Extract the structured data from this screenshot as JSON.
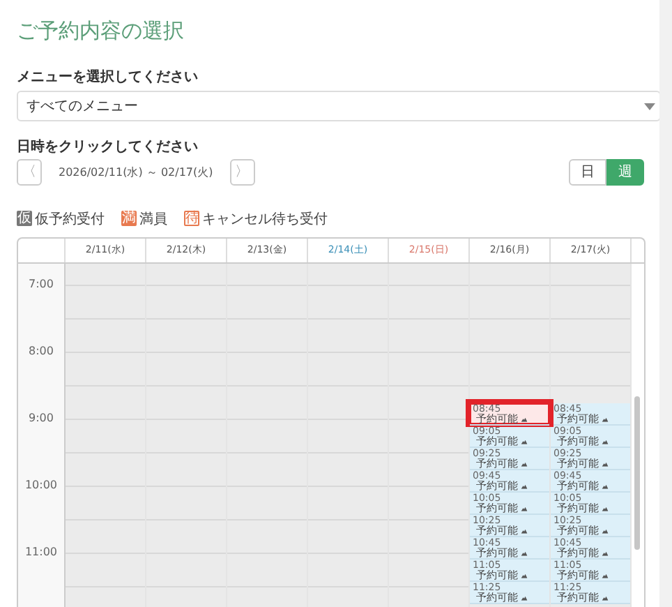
{
  "title": "ご予約内容の選択",
  "menu_label": "メニューを選択してください",
  "menu_select": {
    "value": "すべてのメニュー"
  },
  "date_label": "日時をクリックしてください",
  "date_range": "2026/02/11(水) ～ 02/17(火)",
  "prev_glyph": "〈",
  "next_glyph": "〉",
  "view_toggle": [
    {
      "label": "日",
      "selected": false
    },
    {
      "label": "週",
      "selected": true
    }
  ],
  "legend": [
    {
      "kind": "tentative",
      "mark": "仮",
      "label": "仮予約受付"
    },
    {
      "kind": "full",
      "mark": "満",
      "label": "満員"
    },
    {
      "kind": "waitlist",
      "mark": "待",
      "label": "キャンセル待ち受付"
    }
  ],
  "days": [
    {
      "label": "2/11(水)",
      "kind": "weekday"
    },
    {
      "label": "2/12(木)",
      "kind": "weekday"
    },
    {
      "label": "2/13(金)",
      "kind": "weekday"
    },
    {
      "label": "2/14(土)",
      "kind": "sat"
    },
    {
      "label": "2/15(日)",
      "kind": "sun"
    },
    {
      "label": "2/16(月)",
      "kind": "weekday",
      "slots": [
        {
          "time": "08:45",
          "label": "予約可能",
          "highlighted": true
        },
        {
          "time": "09:05",
          "label": "予約可能",
          "highlighted": false
        },
        {
          "time": "09:25",
          "label": "予約可能",
          "highlighted": false
        },
        {
          "time": "09:45",
          "label": "予約可能",
          "highlighted": false
        },
        {
          "time": "10:05",
          "label": "予約可能",
          "highlighted": false
        },
        {
          "time": "10:25",
          "label": "予約可能",
          "highlighted": false
        },
        {
          "time": "10:45",
          "label": "予約可能",
          "highlighted": false
        },
        {
          "time": "11:05",
          "label": "予約可能",
          "highlighted": false
        },
        {
          "time": "11:25",
          "label": "予約可能",
          "highlighted": false
        }
      ]
    },
    {
      "label": "2/17(火)",
      "kind": "weekday",
      "slots": [
        {
          "time": "08:45",
          "label": "予約可能",
          "highlighted": false
        },
        {
          "time": "09:05",
          "label": "予約可能",
          "highlighted": false
        },
        {
          "time": "09:25",
          "label": "予約可能",
          "highlighted": false
        },
        {
          "time": "09:45",
          "label": "予約可能",
          "highlighted": false
        },
        {
          "time": "10:05",
          "label": "予約可能",
          "highlighted": false
        },
        {
          "time": "10:25",
          "label": "予約可能",
          "highlighted": false
        },
        {
          "time": "10:45",
          "label": "予約可能",
          "highlighted": false
        },
        {
          "time": "11:05",
          "label": "予約可能",
          "highlighted": false
        },
        {
          "time": "11:25",
          "label": "予約可能",
          "highlighted": false
        }
      ]
    }
  ],
  "hours": [
    "7:00",
    "8:00",
    "9:00",
    "10:00",
    "11:00"
  ]
}
